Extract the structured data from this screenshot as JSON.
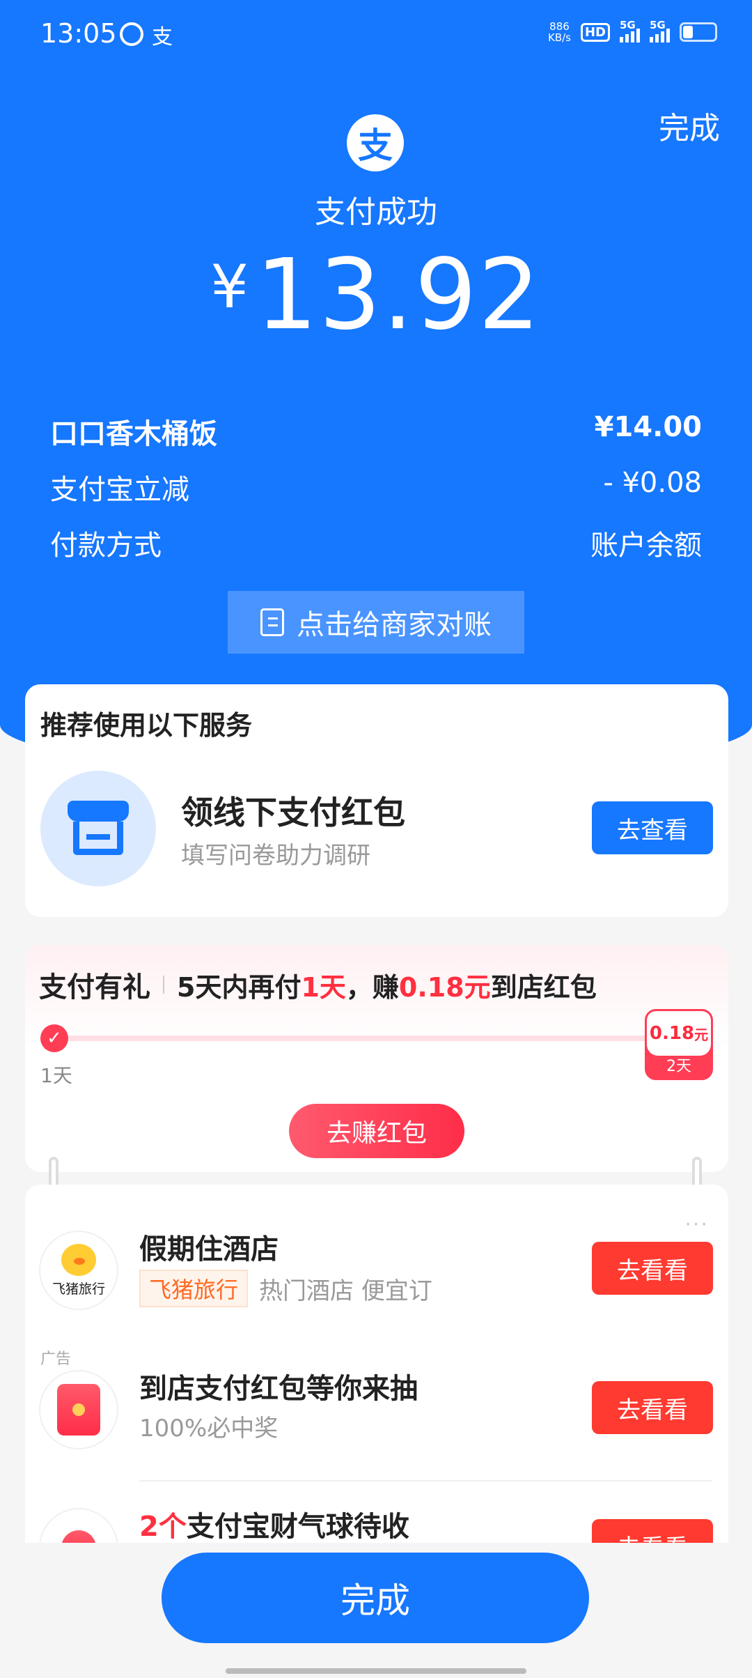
{
  "status_bar": {
    "time": "13:05",
    "app_icon_2": "支",
    "net_speed_value": "886",
    "net_speed_unit": "KB/s",
    "hd_label": "HD",
    "signal_label_1": "5G",
    "signal_label_2": "5G"
  },
  "header": {
    "done_link": "完成",
    "logo_char": "支",
    "status": "支付成功",
    "currency": "¥",
    "amount": "13.92"
  },
  "details": [
    {
      "label": "口口香木桶饭",
      "value": "¥14.00"
    },
    {
      "label": "支付宝立减",
      "value": "- ¥0.08"
    },
    {
      "label": "付款方式",
      "value": "账户余额"
    }
  ],
  "reconcile_button": "点击给商家对账",
  "services_card": {
    "title": "推荐使用以下服务",
    "item_title": "领线下支付红包",
    "item_subtitle": "填写问卷助力调研",
    "button": "去查看"
  },
  "gift_card": {
    "label": "支付有礼",
    "text_part1": "5天内再付",
    "text_highlight1": "1天",
    "text_part2": "，赚",
    "text_highlight2": "0.18元",
    "text_part3": "到店红包",
    "start_label": "1天",
    "reward_amount": "0.18",
    "reward_unit": "元",
    "reward_day": "2天",
    "progress_fraction": 0.5,
    "button": "去赚红包"
  },
  "ads": {
    "more_dots": "···",
    "items": [
      {
        "logo_text": "飞猪旅行",
        "title": "假期住酒店",
        "brand_tag": "飞猪旅行",
        "subtitle": "热门酒店 便宜订",
        "ad_mark": "广告",
        "button": "去看看"
      },
      {
        "title": "到店支付红包等你来抽",
        "subtitle": "100%必中奖",
        "button": "去看看"
      },
      {
        "title_highlight": "2个",
        "title": "支付宝财气球待收",
        "button": "去看看"
      }
    ]
  },
  "bottom": {
    "done_button": "完成"
  },
  "colors": {
    "primary_blue": "#1677ff",
    "accent_red": "#ff3a30",
    "highlight_red": "#ff3040"
  }
}
